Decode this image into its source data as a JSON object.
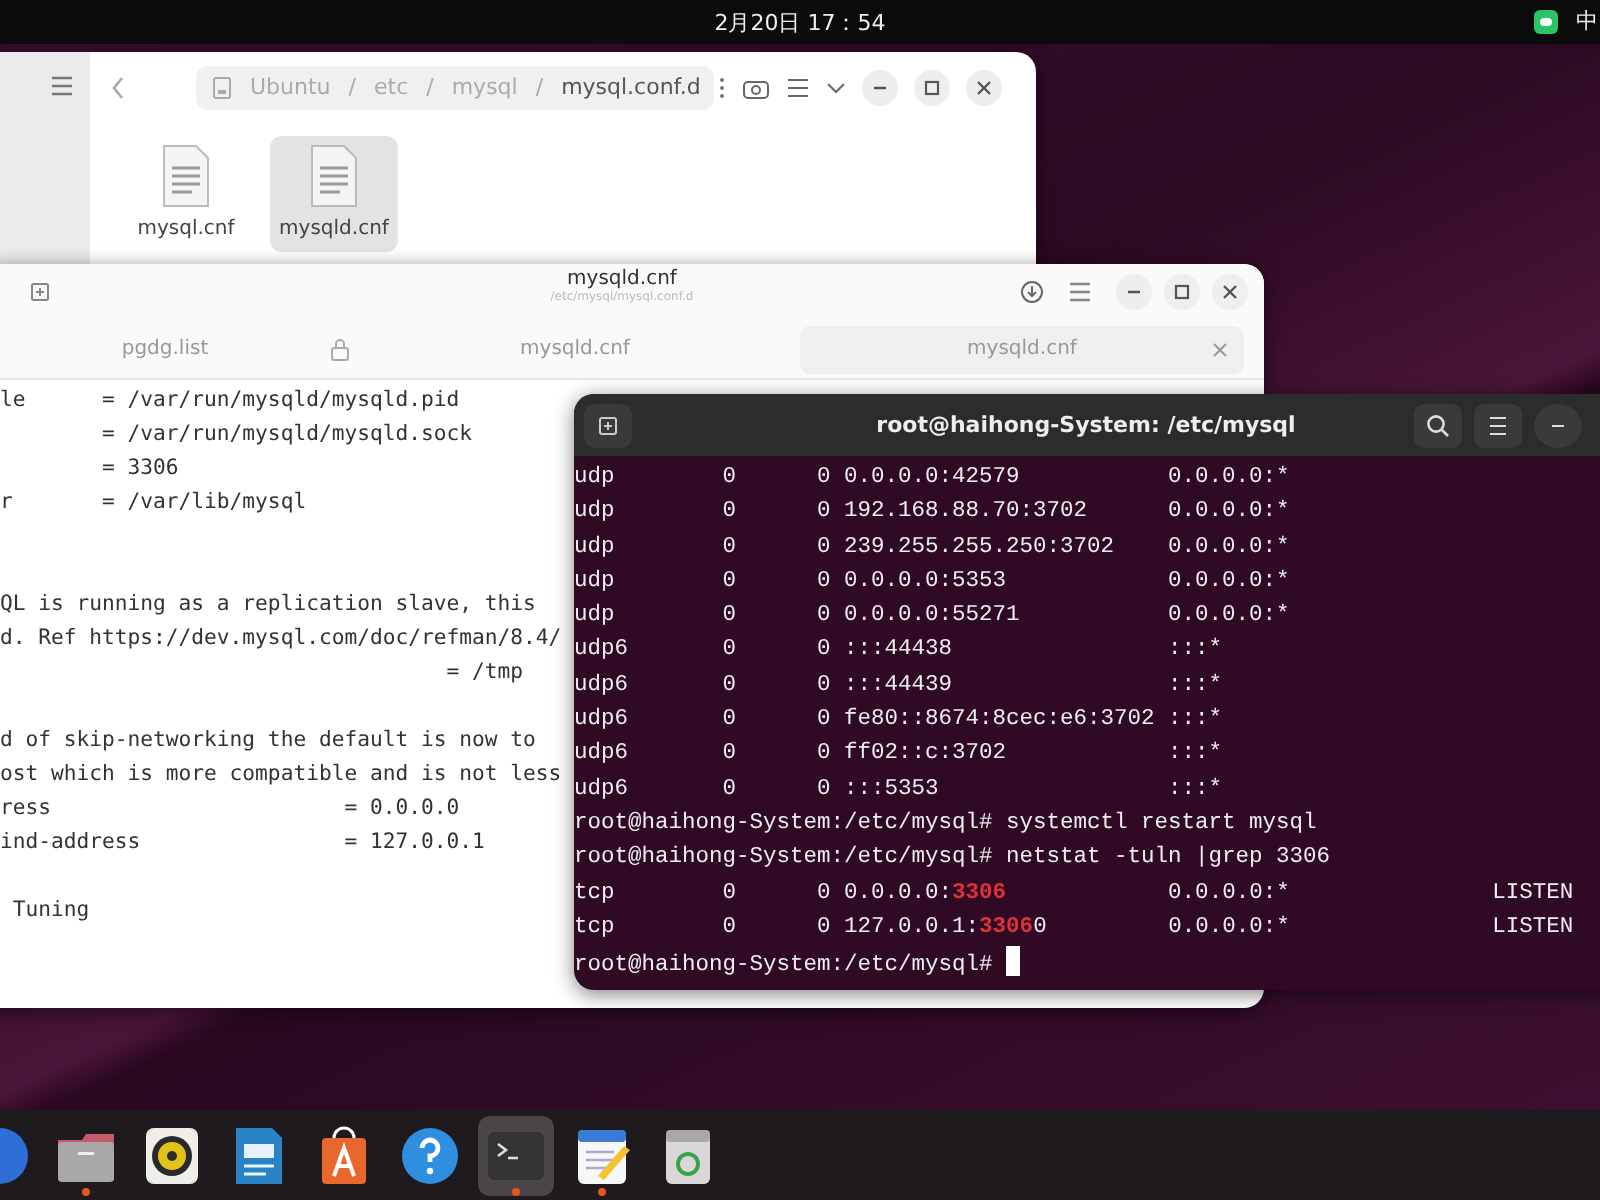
{
  "top_bar": {
    "date_time": "2月20日 17：54",
    "input_method": "中"
  },
  "file_manager": {
    "breadcrumb": {
      "separator": "/",
      "segments": [
        "Ubuntu",
        "etc",
        "mysql",
        "mysql.conf.d"
      ]
    },
    "files": [
      {
        "name": "mysql.cnf",
        "selected": false
      },
      {
        "name": "mysqld.cnf",
        "selected": true
      }
    ]
  },
  "text_editor": {
    "title": "mysqld.cnf",
    "subtitle": "/etc/mysql/mysql.conf.d",
    "tabs": [
      {
        "label": "pgdg.list",
        "selected": false
      },
      {
        "label": "mysqld.cnf",
        "selected": false
      },
      {
        "label": "mysqld.cnf",
        "selected": true
      }
    ],
    "lines": [
      {
        "kind": "code",
        "text": "le      = /var/run/mysqld/mysqld.pid"
      },
      {
        "kind": "code",
        "text": "        = /var/run/mysqld/mysqld.sock"
      },
      {
        "kind": "code",
        "text": "        = 3306"
      },
      {
        "kind": "code",
        "text": "r       = /var/lib/mysql"
      },
      {
        "kind": "blank"
      },
      {
        "kind": "blank"
      },
      {
        "kind": "code",
        "text": "QL is running as a replication slave, this"
      },
      {
        "kind": "code",
        "text": "d. Ref https://dev.mysql.com/doc/refman/8.4/"
      },
      {
        "kind": "code",
        "text": "                                   = /tmp"
      },
      {
        "kind": "blank"
      },
      {
        "kind": "code",
        "text": "d of skip-networking the default is now to"
      },
      {
        "kind": "code",
        "text": "ost which is more compatible and is not less"
      },
      {
        "kind": "code",
        "text": "ress                       = 0.0.0.0"
      },
      {
        "kind": "code",
        "text": "ind-address                = 127.0.0.1"
      },
      {
        "kind": "blank"
      },
      {
        "kind": "code",
        "text": " Tuning"
      }
    ]
  },
  "terminal": {
    "title": "root@haihong-System: /etc/mysql",
    "lines": [
      {
        "parts": [
          {
            "text": "udp        0      0 0.0.0.0:42579           0.0.0.0:*",
            "match": false
          }
        ]
      },
      {
        "parts": [
          {
            "text": "udp        0      0 192.168.88.70:3702      0.0.0.0:*",
            "match": false
          }
        ]
      },
      {
        "parts": [
          {
            "text": "udp        0      0 239.255.255.250:3702    0.0.0.0:*",
            "match": false
          }
        ]
      },
      {
        "parts": [
          {
            "text": "udp        0      0 0.0.0.0:5353            0.0.0.0:*",
            "match": false
          }
        ]
      },
      {
        "parts": [
          {
            "text": "udp        0      0 0.0.0.0:55271           0.0.0.0:*",
            "match": false
          }
        ]
      },
      {
        "parts": [
          {
            "text": "udp6       0      0 :::44438                :::*",
            "match": false
          }
        ]
      },
      {
        "parts": [
          {
            "text": "udp6       0      0 :::44439                :::*",
            "match": false
          }
        ]
      },
      {
        "parts": [
          {
            "text": "udp6       0      0 fe80::8674:8cec:e6:3702 :::*",
            "match": false
          }
        ]
      },
      {
        "parts": [
          {
            "text": "udp6       0      0 ff02::c:3702            :::*",
            "match": false
          }
        ]
      },
      {
        "parts": [
          {
            "text": "udp6       0      0 :::5353                 :::*",
            "match": false
          }
        ]
      },
      {
        "parts": [
          {
            "text": "root@haihong-System:/etc/mysql# systemctl restart mysql",
            "match": false
          }
        ]
      },
      {
        "parts": [
          {
            "text": "root@haihong-System:/etc/mysql# netstat -tuln |grep 3306",
            "match": false
          }
        ]
      },
      {
        "parts": [
          {
            "text": "tcp        0      0 0.0.0.0:",
            "match": false
          },
          {
            "text": "3306",
            "match": true
          },
          {
            "text": "            0.0.0.0:*               LISTEN",
            "match": false
          }
        ]
      },
      {
        "parts": [
          {
            "text": "tcp        0      0 127.0.0.1:",
            "match": false
          },
          {
            "text": "3306",
            "match": true
          },
          {
            "text": "0         0.0.0.0:*               LISTEN",
            "match": false
          }
        ]
      },
      {
        "parts": [
          {
            "text": "root@haihong-System:/etc/mysql# ",
            "match": false
          }
        ],
        "cursor": true
      }
    ]
  },
  "dock": {
    "apps": [
      {
        "kind": "circle-app",
        "running": false,
        "focused": false
      },
      {
        "kind": "files",
        "running": true,
        "focused": false
      },
      {
        "kind": "speaker",
        "running": false,
        "focused": false
      },
      {
        "kind": "writer",
        "running": false,
        "focused": false
      },
      {
        "kind": "store",
        "running": false,
        "focused": false
      },
      {
        "kind": "help",
        "running": false,
        "focused": false
      },
      {
        "kind": "terminal",
        "running": true,
        "focused": true
      },
      {
        "kind": "editor",
        "running": true,
        "focused": false
      },
      {
        "kind": "trash",
        "running": false,
        "focused": false
      }
    ]
  }
}
